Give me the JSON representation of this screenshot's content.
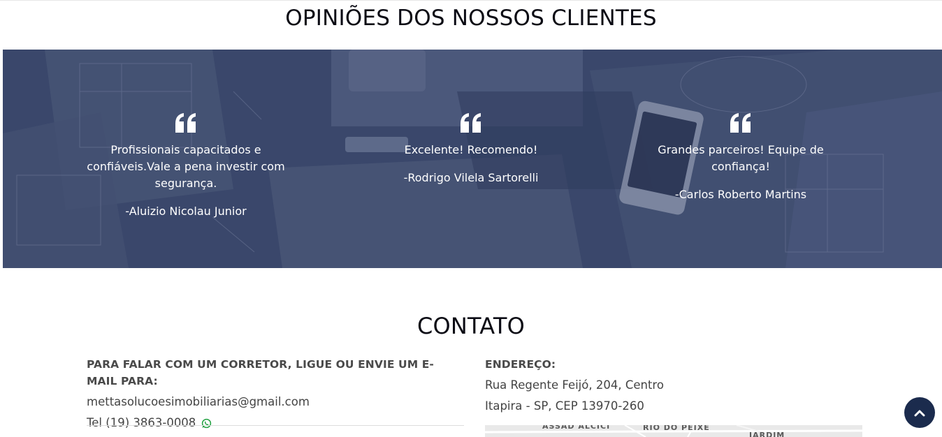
{
  "testimonials": {
    "title": "OPINIÕES DOS NOSSOS CLIENTES",
    "items": [
      {
        "text": "Profissionais capacitados e confiáveis.Vale a pena investir com segurança.",
        "author": "-Aluizio Nicolau Junior"
      },
      {
        "text": "Excelente! Recomendo!",
        "author": "-Rodrigo Vilela Sartorelli"
      },
      {
        "text": "Grandes parceiros! Equipe de confiança!",
        "author": "-Carlos Roberto Martins"
      }
    ],
    "overlay_color": "#3d4a6b",
    "quote_icon": "quote-left-icon"
  },
  "contact": {
    "title": "CONTATO",
    "left": {
      "heading": "PARA FALAR COM UM CORRETOR, LIGUE OU ENVIE UM E-MAIL PARA:",
      "email": "mettasolucoesimobiliarias@gmail.com",
      "phone": "Tel (19) 3863-0008",
      "phone_icon": "whatsapp-icon",
      "whatsapp_color": "#25a244"
    },
    "right": {
      "heading": "ENDEREÇO:",
      "address_line1": "Rua Regente Feijó, 204, Centro",
      "address_line2": "Itapira - SP, CEP 13970-260"
    },
    "map": {
      "labels": [
        "ASSAD ALCICI",
        "RIO DO PEIXE",
        "JARDIM"
      ]
    }
  },
  "back_to_top": {
    "icon": "chevron-up-icon",
    "color": "#1b2b4d"
  }
}
